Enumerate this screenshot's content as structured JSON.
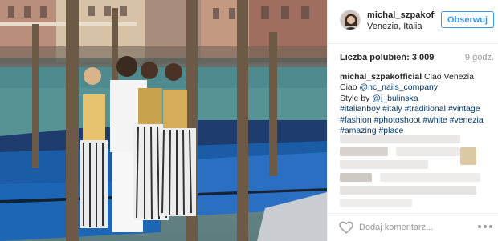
{
  "post": {
    "photo_alt": "",
    "header": {
      "username": "michal_szpakoffi...",
      "location": "Venezia, Italia",
      "follow_label": "Obserwuj"
    },
    "likes_label": "Liczba polubień: 3 009",
    "time_label": "9 godz.",
    "caption": {
      "author": "michal_szpakofficial",
      "line1_text": " Ciao Venezia",
      "line2_prefix": "Ciao ",
      "line2_mention": "@nc_nails_company",
      "line3_prefix": "Style by ",
      "line3_mention": "@j_bulinska",
      "line4": [
        "#italianboy",
        "#italy",
        "#traditional",
        "#vintage"
      ],
      "line5": [
        "#fashion",
        "#photoshoot",
        "#white",
        "#venezia"
      ],
      "line6": [
        "#amazing",
        "#place"
      ]
    },
    "comment": {
      "placeholder": "Dodaj komentarz..."
    },
    "icons": {
      "like": "heart-icon",
      "more": "ellipsis-icon"
    },
    "colors": {
      "follow_blue": "#3897f0",
      "hashtag": "#003569",
      "muted": "#999999"
    }
  }
}
